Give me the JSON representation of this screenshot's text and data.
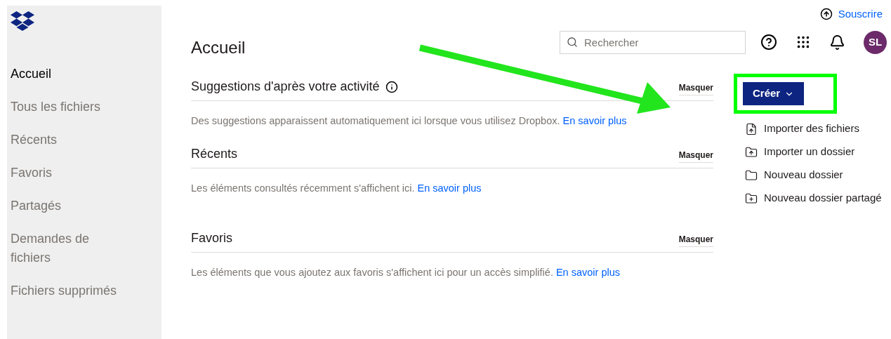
{
  "sidebar": {
    "items": [
      {
        "label": "Accueil",
        "selected": true
      },
      {
        "label": "Tous les fichiers",
        "selected": false
      },
      {
        "label": "Récents",
        "selected": false
      },
      {
        "label": "Favoris",
        "selected": false
      },
      {
        "label": "Partagés",
        "selected": false
      },
      {
        "label": "Demandes de fichiers",
        "selected": false
      },
      {
        "label": "Fichiers supprimés",
        "selected": false
      }
    ]
  },
  "upgrade_link": "Souscrire",
  "page_title": "Accueil",
  "search": {
    "placeholder": "Rechercher"
  },
  "avatar": {
    "initials": "SL",
    "color": "#6c2a6a"
  },
  "sections": [
    {
      "title": "Suggestions d'après votre activité",
      "info": true,
      "hide": "Masquer",
      "text": "Des suggestions apparaissent automatiquement ici lorsque vous utilisez Dropbox.",
      "link": "En savoir plus"
    },
    {
      "title": "Récents",
      "info": false,
      "hide": "Masquer",
      "text": "Les éléments consultés récemment s'affichent ici.",
      "link": "En savoir plus"
    },
    {
      "title": "Favoris",
      "info": false,
      "hide": "Masquer",
      "text": "Les éléments que vous ajoutez aux favoris s'affichent ici pour un accès simplifié.",
      "link": "En savoir plus"
    }
  ],
  "create_button": {
    "label": "Créer",
    "highlighted": true
  },
  "actions": [
    {
      "kind": "file-upload",
      "label": "Importer des fichiers"
    },
    {
      "kind": "folder-upload",
      "label": "Importer un dossier"
    },
    {
      "kind": "folder",
      "label": "Nouveau dossier"
    },
    {
      "kind": "shared-folder",
      "label": "Nouveau dossier partagé"
    }
  ],
  "annotations": [
    {
      "kind": "arrow"
    }
  ]
}
